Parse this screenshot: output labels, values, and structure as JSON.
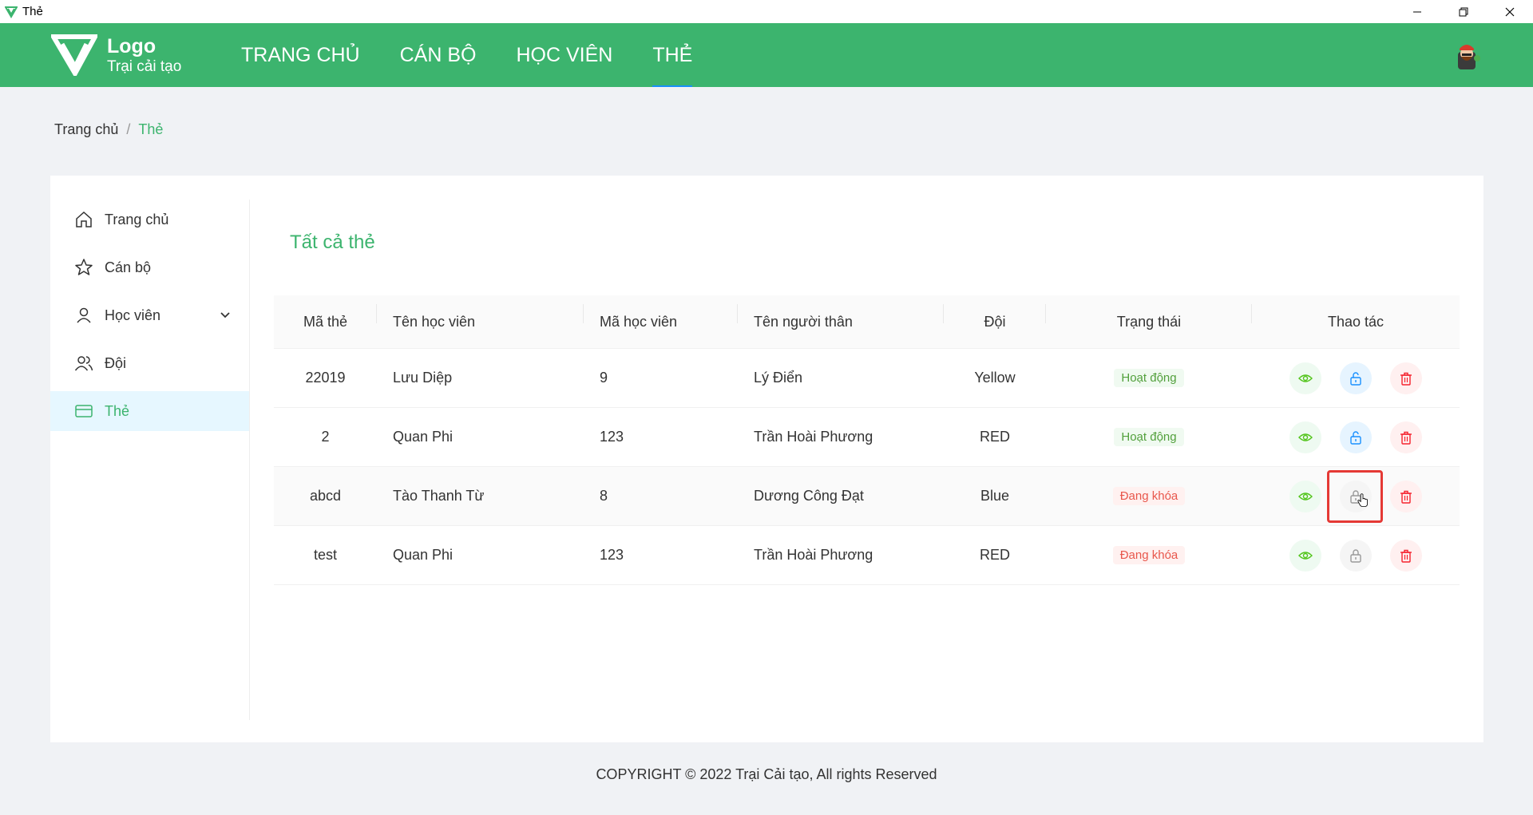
{
  "window": {
    "title": "Thẻ"
  },
  "header": {
    "logo_title": "Logo",
    "logo_subtitle": "Trại cải tạo",
    "nav": [
      {
        "label": "TRANG CHỦ"
      },
      {
        "label": "CÁN BỘ"
      },
      {
        "label": "HỌC VIÊN"
      },
      {
        "label": "THẺ",
        "active": true
      }
    ]
  },
  "breadcrumb": {
    "home": "Trang chủ",
    "separator": "/",
    "current": "Thẻ"
  },
  "sidebar": {
    "items": [
      {
        "label": "Trang chủ",
        "icon": "home-icon"
      },
      {
        "label": "Cán bộ",
        "icon": "star-icon"
      },
      {
        "label": "Học viên",
        "icon": "user-icon",
        "expandable": true
      },
      {
        "label": "Đội",
        "icon": "team-icon"
      },
      {
        "label": "Thẻ",
        "icon": "card-icon",
        "active": true
      }
    ]
  },
  "main": {
    "title": "Tất cả thẻ",
    "table": {
      "headers": [
        "Mã thẻ",
        "Tên học viên",
        "Mã học viên",
        "Tên người thân",
        "Đội",
        "Trạng thái",
        "Thao tác"
      ],
      "rows": [
        {
          "ma_the": "22019",
          "ten_hoc_vien": "Lưu Diệp",
          "ma_hoc_vien": "9",
          "ten_nguoi_than": "Lý Điển",
          "doi": "Yellow",
          "trang_thai": "Hoạt động",
          "status": "active"
        },
        {
          "ma_the": "2",
          "ten_hoc_vien": "Quan Phi",
          "ma_hoc_vien": "123",
          "ten_nguoi_than": "Trần Hoài Phương",
          "doi": "RED",
          "trang_thai": "Hoạt động",
          "status": "active"
        },
        {
          "ma_the": "abcd",
          "ten_hoc_vien": "Tào Thanh Từ",
          "ma_hoc_vien": "8",
          "ten_nguoi_than": "Dương Công Đạt",
          "doi": "Blue",
          "trang_thai": "Đang khóa",
          "status": "locked"
        },
        {
          "ma_the": "test",
          "ten_hoc_vien": "Quan Phi",
          "ma_hoc_vien": "123",
          "ten_nguoi_than": "Trần Hoài Phương",
          "doi": "RED",
          "trang_thai": "Đang khóa",
          "status": "locked"
        }
      ]
    }
  },
  "footer": {
    "text": "COPYRIGHT © 2022 Trại Cải tạo, All rights Reserved"
  },
  "colors": {
    "primary": "#3cb46e",
    "active_tag": "#52a03c",
    "locked_tag": "#e8574c",
    "link_blue": "#1890ff"
  }
}
